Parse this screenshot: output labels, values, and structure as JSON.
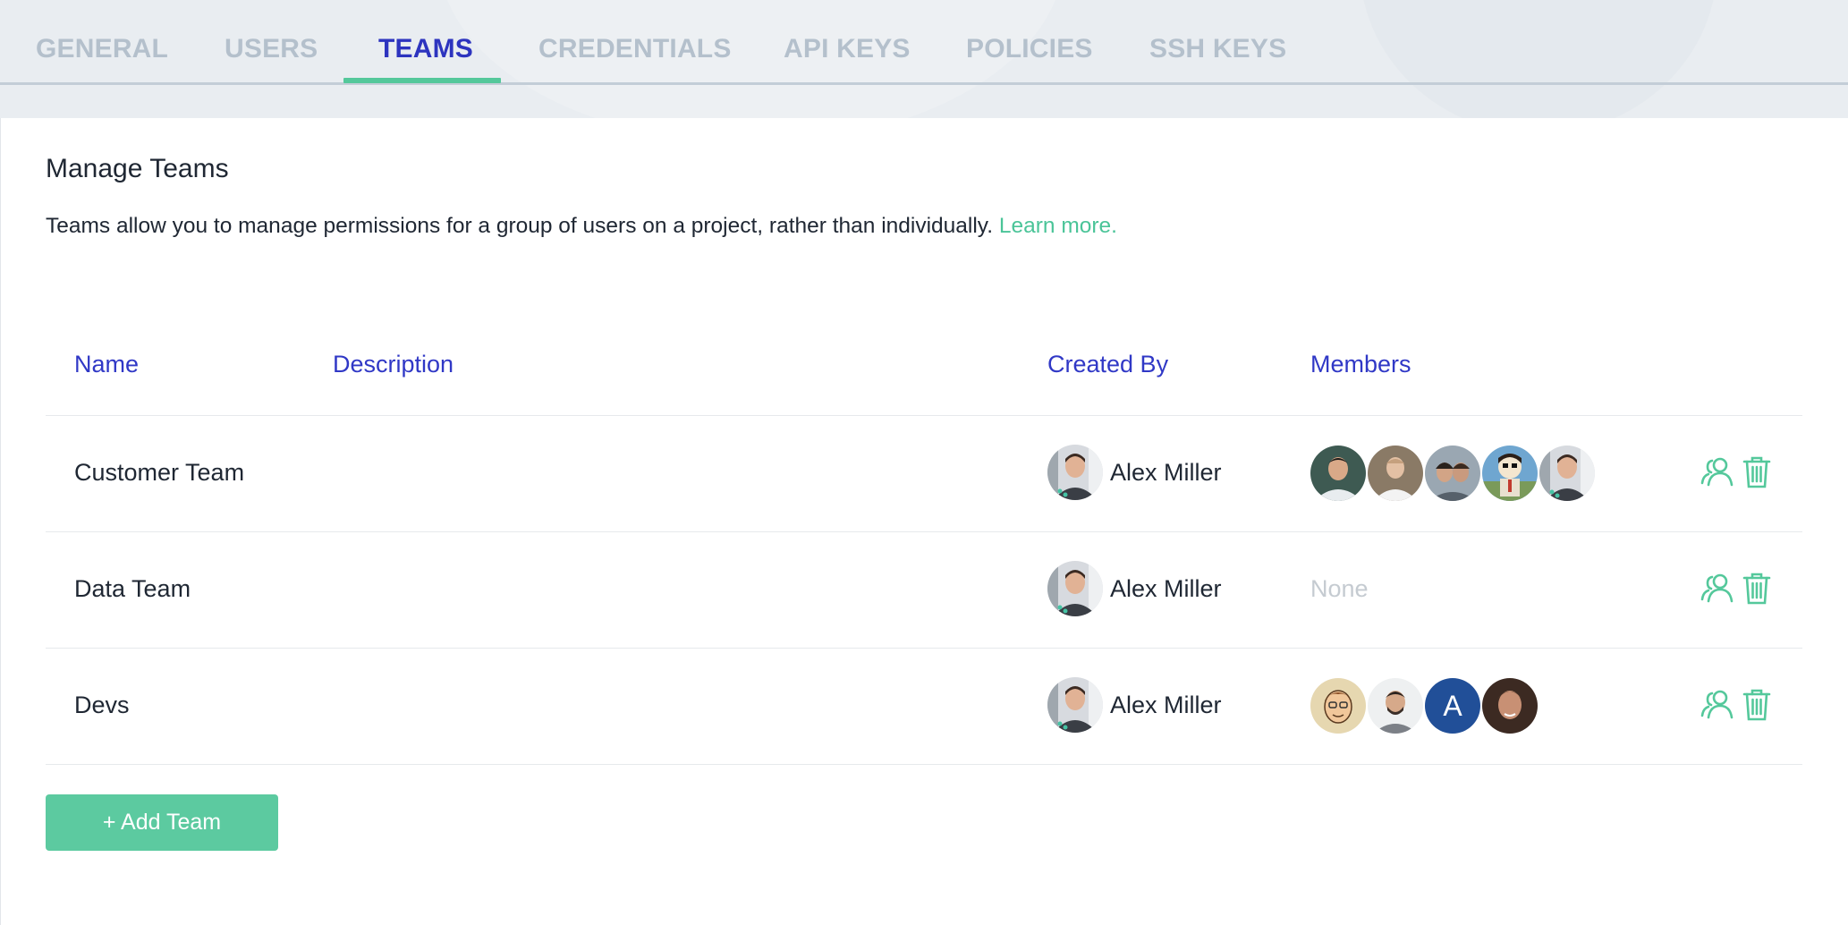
{
  "tabs": [
    {
      "label": "GENERAL"
    },
    {
      "label": "USERS"
    },
    {
      "label": "TEAMS"
    },
    {
      "label": "CREDENTIALS"
    },
    {
      "label": "API KEYS"
    },
    {
      "label": "POLICIES"
    },
    {
      "label": "SSH KEYS"
    }
  ],
  "active_tab": "TEAMS",
  "main": {
    "title": "Manage Teams",
    "intro_text": "Teams allow you to manage permissions for a group of users on a project, rather than individually.",
    "intro_link": "Learn more."
  },
  "table": {
    "headers": {
      "name": "Name",
      "description": "Description",
      "created_by": "Created By",
      "members": "Members"
    },
    "rows": [
      {
        "name": "Customer Team",
        "description": "",
        "created_by": "Alex Miller",
        "members_none": ""
      },
      {
        "name": "Data Team",
        "description": "",
        "created_by": "Alex Miller",
        "members_none": "None"
      },
      {
        "name": "Devs",
        "description": "",
        "created_by": "Alex Miller",
        "members_none": ""
      }
    ],
    "devs_letter_avatar": "A"
  },
  "actions": {
    "manage_members_icon": "users-icon",
    "delete_icon": "trash-icon"
  },
  "add_button_label": "+ Add Team",
  "colors": {
    "active_tab": "#2d34bf",
    "accent_green": "#54c89b",
    "header_blue": "#3038c6",
    "inactive_tab": "#b4c0cc",
    "button": "#5ccaa0"
  }
}
